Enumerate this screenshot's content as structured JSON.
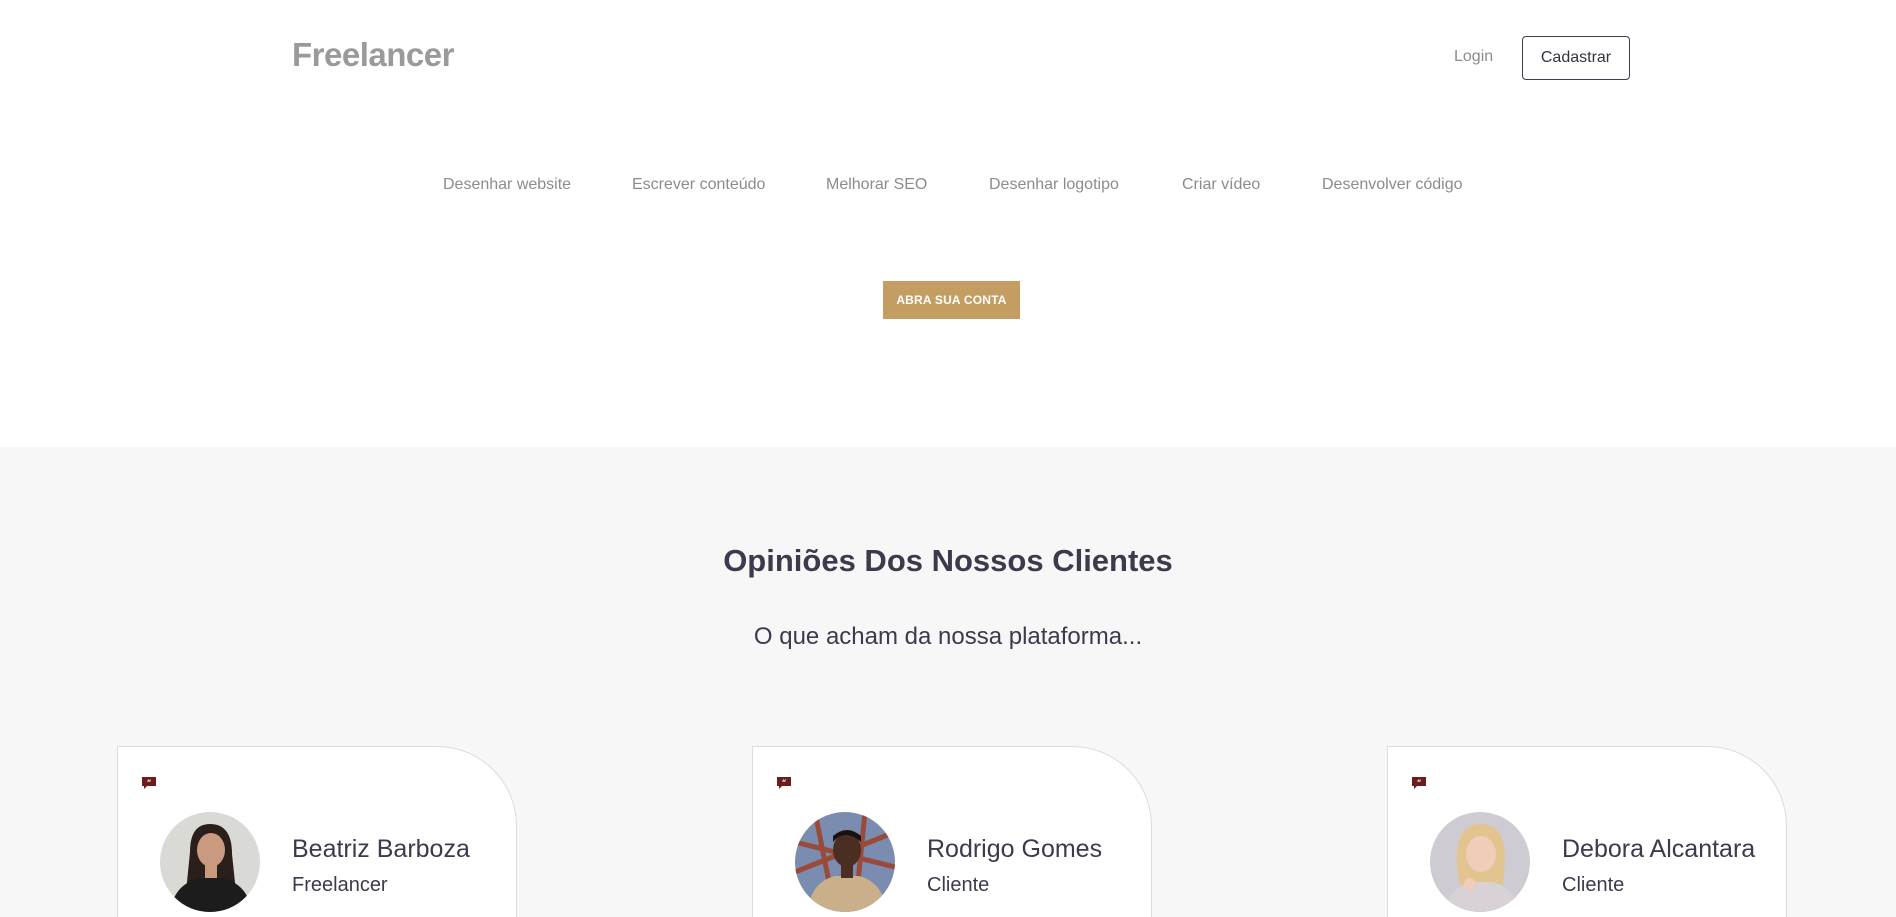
{
  "header": {
    "brand": "Freelancer",
    "login_label": "Login",
    "signup_label": "Cadastrar"
  },
  "categories": [
    "Desenhar website",
    "Escrever conteúdo",
    "Melhorar SEO",
    "Desenhar logotipo",
    "Criar vídeo",
    "Desenvolver código"
  ],
  "cta": {
    "label": "ABRA SUA CONTA"
  },
  "testimonials": {
    "title": "Opiniões Dos Nossos Clientes",
    "subtitle": "O que acham da nossa plataforma...",
    "cards": [
      {
        "name": "Beatriz Barboza",
        "role": "Freelancer"
      },
      {
        "name": "Rodrigo Gomes",
        "role": "Cliente"
      },
      {
        "name": "Debora Alcantara",
        "role": "Cliente"
      }
    ]
  },
  "colors": {
    "brand_gray": "#9a9a9a",
    "cta_gold": "#c49d63",
    "heading_dark": "#3c3a4d",
    "quote_icon": "#6b1d1d",
    "section_bg": "#f7f7f7"
  }
}
